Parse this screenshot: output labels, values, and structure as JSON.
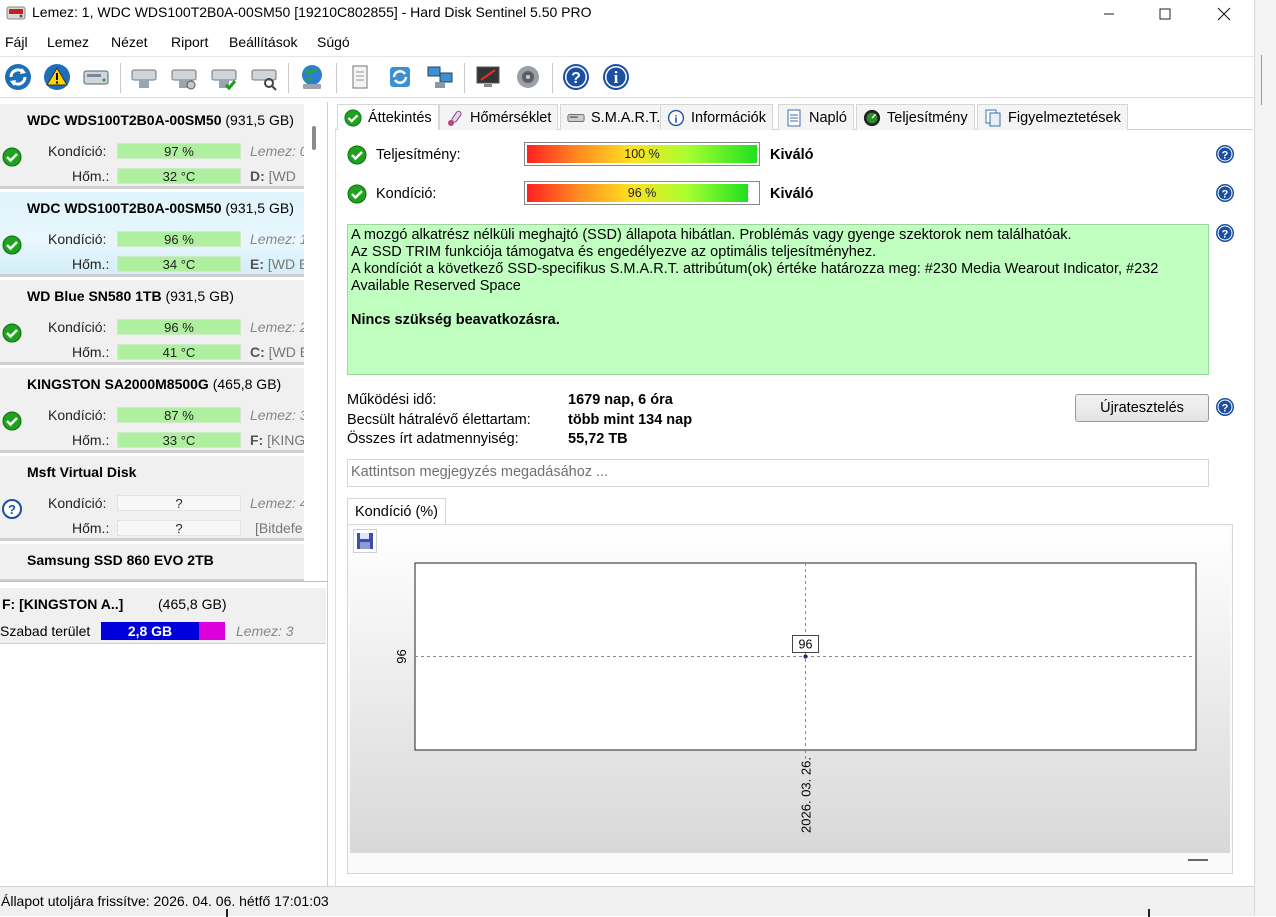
{
  "window": {
    "title": "Lemez: 1, WDC  WDS100T2B0A-00SM50 [19210C802855]  -  Hard Disk Sentinel 5.50 PRO"
  },
  "menu": [
    "Fájl",
    "Lemez",
    "Nézet",
    "Riport",
    "Beállítások",
    "Súgó"
  ],
  "toolbar_icons": [
    "refresh-icon",
    "alert-icon",
    "disk-icon",
    "disk-tools-icon",
    "disk-test-icon",
    "disk-check-icon",
    "disk-search-icon",
    "globe-icon",
    "report-icon",
    "sync-icon",
    "network-icon",
    "monitor-icon",
    "speaker-icon",
    "help-icon",
    "info-icon"
  ],
  "disks": [
    {
      "name": "WDC  WDS100T2B0A-00SM50",
      "size": "(931,5 GB)",
      "health_label": "Kondíció:",
      "health": "97 %",
      "temp_label": "Hőm.:",
      "temp": "32 °C",
      "extra1": "Lemez: 0",
      "extra2_bold": "D:",
      "extra2": " [WD",
      "status": "ok"
    },
    {
      "name": "WDC  WDS100T2B0A-00SM50",
      "size": "(931,5 GB)",
      "health_label": "Kondíció:",
      "health": "96 %",
      "temp_label": "Hőm.:",
      "temp": "34 °C",
      "extra1": "Lemez: 1",
      "extra2_bold": "E:",
      "extra2": " [WD E",
      "status": "ok"
    },
    {
      "name": "WD Blue SN580 1TB",
      "size": "(931,5 GB)",
      "health_label": "Kondíció:",
      "health": "96 %",
      "temp_label": "Hőm.:",
      "temp": "41 °C",
      "extra1": "Lemez: 2",
      "extra2_bold": "C:",
      "extra2": " [WD E",
      "status": "ok"
    },
    {
      "name": "KINGSTON SA2000M8500G",
      "size": "(465,8 GB)",
      "health_label": "Kondíció:",
      "health": "87 %",
      "temp_label": "Hőm.:",
      "temp": "33 °C",
      "extra1": "Lemez: 3",
      "extra2_bold": "F:",
      "extra2": " [KING",
      "status": "ok"
    },
    {
      "name": "Msft    Virtual Disk",
      "size": "",
      "health_label": "Kondíció:",
      "health": "?",
      "temp_label": "Hőm.:",
      "temp": "?",
      "extra1": "Lemez: 4",
      "extra2_bold": "",
      "extra2": "[Bitdefe",
      "status": "unknown"
    },
    {
      "name": "Samsung SSD 860 EVO 2TB",
      "size": "",
      "status": "none"
    }
  ],
  "partition": {
    "name": "F: [KINGSTON A..]",
    "size": "(465,8 GB)",
    "free_label": "Szabad terület",
    "free_value": "2,8 GB",
    "free_fraction": 0.79,
    "disk_ref": "Lemez: 3"
  },
  "tabs": [
    {
      "label": "Áttekintés",
      "icon": "check-icon"
    },
    {
      "label": "Hőmérséklet",
      "icon": "thermometer-icon"
    },
    {
      "label": "S.M.A.R.T.",
      "icon": "smart-disk-icon"
    },
    {
      "label": "Információk",
      "icon": "info-icon"
    },
    {
      "label": "Napló",
      "icon": "log-icon"
    },
    {
      "label": "Teljesítmény",
      "icon": "performance-icon"
    },
    {
      "label": "Figyelmeztetések",
      "icon": "alerts-icon"
    }
  ],
  "overview": {
    "performance_label": "Teljesítmény:",
    "performance_value": "100 %",
    "performance_grade": "Kiváló",
    "health_label": "Kondíció:",
    "health_value": "96 %",
    "health_grade": "Kiváló",
    "message_lines": [
      "A mozgó alkatrész nélküli meghajtó (SSD) állapota hibátlan. Problémás vagy gyenge szektorok nem találhatóak.",
      "Az SSD TRIM funkciója támogatva és engedélyezve az optimális teljesítményhez.",
      "A kondíciót a következő SSD-specifikus S.M.A.R.T. attribútum(ok) értéke határozza meg:  #230 Media Wearout Indicator, #232 Available Reserved Space"
    ],
    "message_bold": "Nincs szükség beavatkozásra.",
    "power_on_label": "Működési idő:",
    "power_on_value": "1679 nap, 6 óra",
    "lifetime_label": "Becsült hátralévő élettartam:",
    "lifetime_value": "több mint 134 nap",
    "written_label": "Összes írt adatmennyiség:",
    "written_value": "55,72 TB",
    "retest_button": "Újratesztelés",
    "note_placeholder": "Kattintson megjegyzés megadásához ..."
  },
  "chart_tab_label": "Kondíció  (%)",
  "chart_data": {
    "type": "line",
    "title": "Kondíció  (%)",
    "x": [
      "2026. 03. 26."
    ],
    "series": [
      {
        "values": [
          96
        ]
      }
    ],
    "xlabel": "",
    "ylabel": "",
    "data_labels": [
      "96"
    ],
    "y_tick_labels": [
      "96"
    ]
  },
  "statusbar": {
    "text": "Állapot utoljára frissítve: 2026. 04. 06. hétfő 17:01:03"
  }
}
